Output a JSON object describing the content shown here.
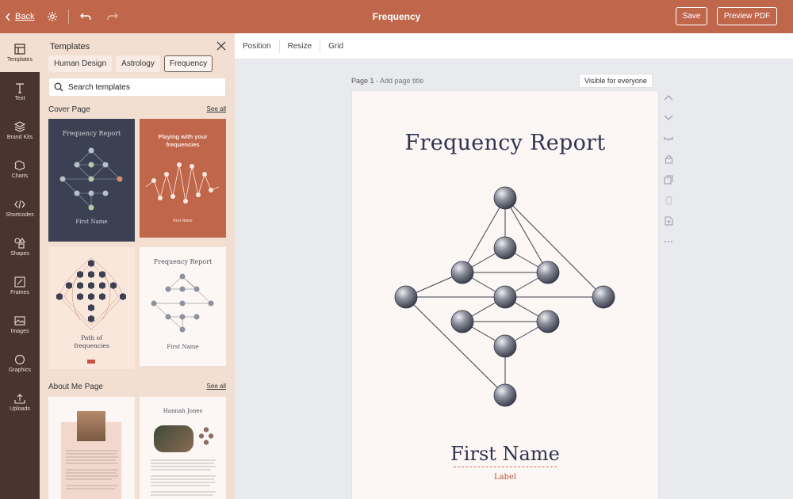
{
  "topbar": {
    "back_label": "Back",
    "title": "Frequency",
    "save_label": "Save",
    "preview_label": "Preview PDF"
  },
  "rail": [
    {
      "label": "Templates",
      "icon": "templates-icon"
    },
    {
      "label": "Text",
      "icon": "text-icon"
    },
    {
      "label": "Brand Kits",
      "icon": "brand-kits-icon"
    },
    {
      "label": "Charts",
      "icon": "charts-icon"
    },
    {
      "label": "Shortcodes",
      "icon": "code-icon"
    },
    {
      "label": "Shapes",
      "icon": "shapes-icon"
    },
    {
      "label": "Frames",
      "icon": "frames-icon"
    },
    {
      "label": "Images",
      "icon": "image-icon"
    },
    {
      "label": "Graphics",
      "icon": "graphics-icon"
    },
    {
      "label": "Uploads",
      "icon": "upload-icon"
    }
  ],
  "panel": {
    "title": "Templates",
    "chips": [
      "Human Design",
      "Astrology",
      "Frequency"
    ],
    "active_chip": "Frequency",
    "search_placeholder": "Search templates",
    "sections": [
      {
        "title": "Cover Page",
        "see_all": "See all"
      },
      {
        "title": "About Me Page",
        "see_all": "See all"
      }
    ],
    "thumbs": {
      "t1_title": "Frequency Report",
      "t1_name": "First Name",
      "t2_title_1": "Playing with your",
      "t2_title_2": "frequencies",
      "t2_name": "First Name",
      "t3_title_1": "Path of",
      "t3_title_2": "frequencies",
      "t4_title": "Frequency Report",
      "t4_name": "First Name",
      "t6_name": "Hannah Jones"
    }
  },
  "toolbar": {
    "items": [
      "Position",
      "Resize",
      "Grid"
    ]
  },
  "page": {
    "number_label": "Page 1",
    "title_placeholder": "- Add page title",
    "visibility": "Visible for everyone",
    "heading": "Frequency Report",
    "first_name": "First Name",
    "label": "Label"
  },
  "colors": {
    "accent": "#c0664b",
    "rail": "#4a3430",
    "panel": "#f2dfd2",
    "navy": "#2f3450"
  }
}
